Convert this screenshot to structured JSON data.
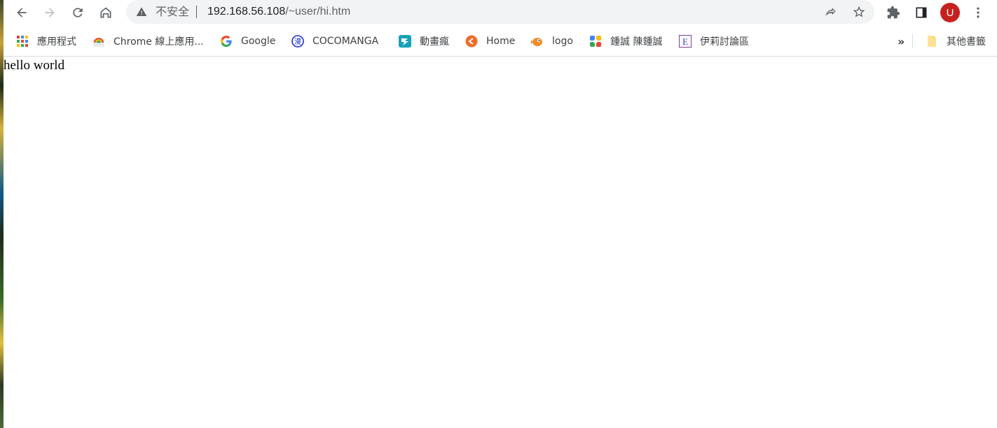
{
  "toolbar": {
    "security_label": "不安全",
    "url_host": "192.168.56.108",
    "url_path": "/~user/hi.htm",
    "avatar_letter": "U"
  },
  "bookmarks": [
    {
      "label": "應用程式",
      "icon": "apps-grid-icon"
    },
    {
      "label": "Chrome 線上應用...",
      "icon": "chrome-webstore-icon"
    },
    {
      "label": "Google",
      "icon": "google-icon"
    },
    {
      "label": "COCOMANGA",
      "icon": "cocomanga-icon"
    },
    {
      "label": "動畫瘋",
      "icon": "anime-crazy-icon"
    },
    {
      "label": "Home",
      "icon": "home-bookmark-icon"
    },
    {
      "label": "logo",
      "icon": "logo-bookmark-icon"
    },
    {
      "label": "鍾誠 陳鍾誠",
      "icon": "chen-bookmark-icon"
    },
    {
      "label": "伊莉討論區",
      "icon": "eyny-icon"
    }
  ],
  "bookmarks_overflow": "»",
  "other_bookmarks": {
    "label": "其他書籤",
    "icon": "folder-icon"
  },
  "page": {
    "body_text": "hello world"
  },
  "colors": {
    "omnibox_bg": "#f1f3f4",
    "avatar": "#c5221f",
    "toolbar_icon": "#5f6368"
  }
}
